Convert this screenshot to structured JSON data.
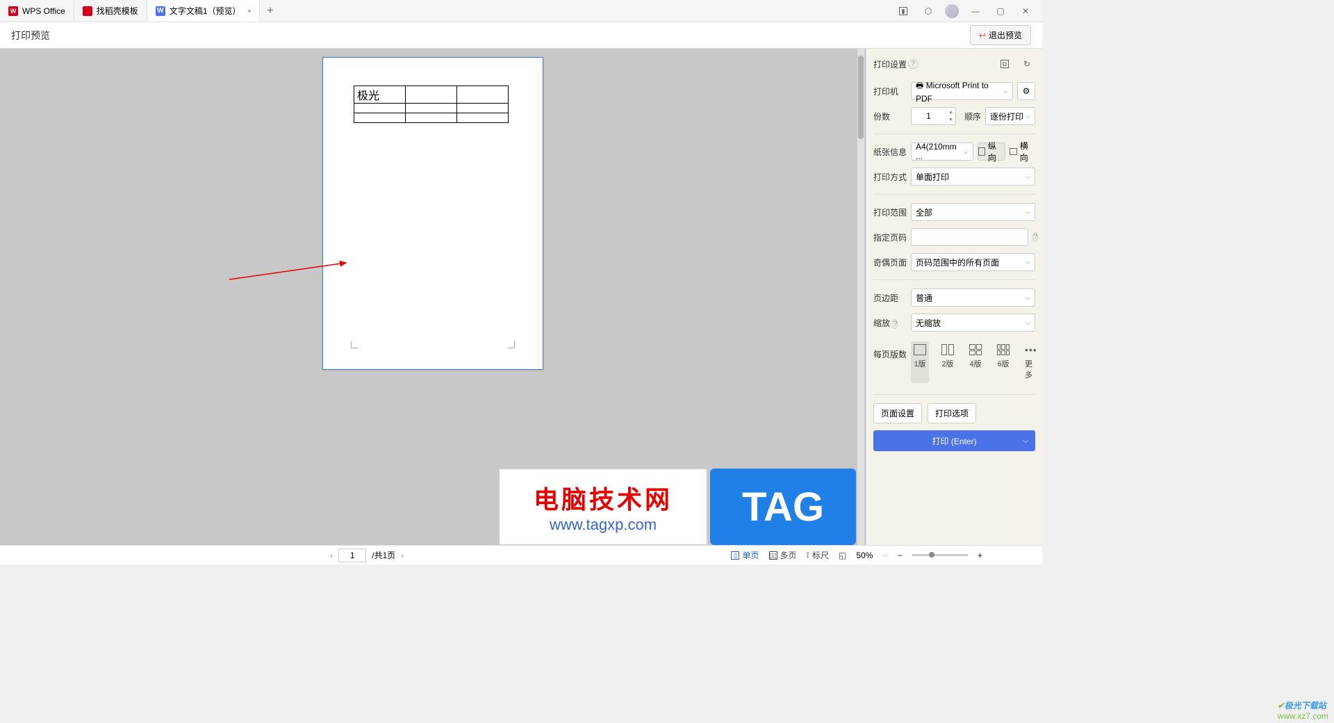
{
  "tabs": [
    {
      "label": "WPS Office"
    },
    {
      "label": "找稻壳模板"
    },
    {
      "label": "文字文稿1（预览）"
    }
  ],
  "toolbar": {
    "title": "打印预览",
    "exit_label": "退出预览"
  },
  "document": {
    "cell_text": "极光"
  },
  "sidebar": {
    "title": "打印设置",
    "printer_label": "打印机",
    "printer_value": "Microsoft Print to PDF",
    "copies_label": "份数",
    "copies_value": "1",
    "order_label": "顺序",
    "order_value": "逐份打印",
    "paper_label": "纸张信息",
    "paper_value": "A4(210mm ...",
    "portrait_label": "纵向",
    "landscape_label": "横向",
    "duplex_label": "打印方式",
    "duplex_value": "单面打印",
    "range_label": "打印范围",
    "range_value": "全部",
    "pages_label": "指定页码",
    "pages_value": "",
    "odd_even_label": "奇偶页面",
    "odd_even_value": "页码范围中的所有页面",
    "margin_label": "页边距",
    "margin_value": "普通",
    "scale_label": "缩放",
    "scale_value": "无缩放",
    "layout_label": "每页版数",
    "layout_1": "1版",
    "layout_2": "2版",
    "layout_4": "4版",
    "layout_6": "6版",
    "layout_more": "更多",
    "page_setup": "页面设置",
    "print_options": "打印选项",
    "print_button": "打印 (Enter)"
  },
  "statusbar": {
    "page_current": "1",
    "page_total": "/共1页",
    "single_page": "单页",
    "multi_page": "多页",
    "ruler": "标尺",
    "zoom_value": "50%",
    "watermark_cn": "极光下载站",
    "watermark_url": "www.xz7.com"
  },
  "overlay": {
    "brand_cn": "电脑技术网",
    "brand_url": "www.tagxp.com",
    "tag": "TAG"
  }
}
